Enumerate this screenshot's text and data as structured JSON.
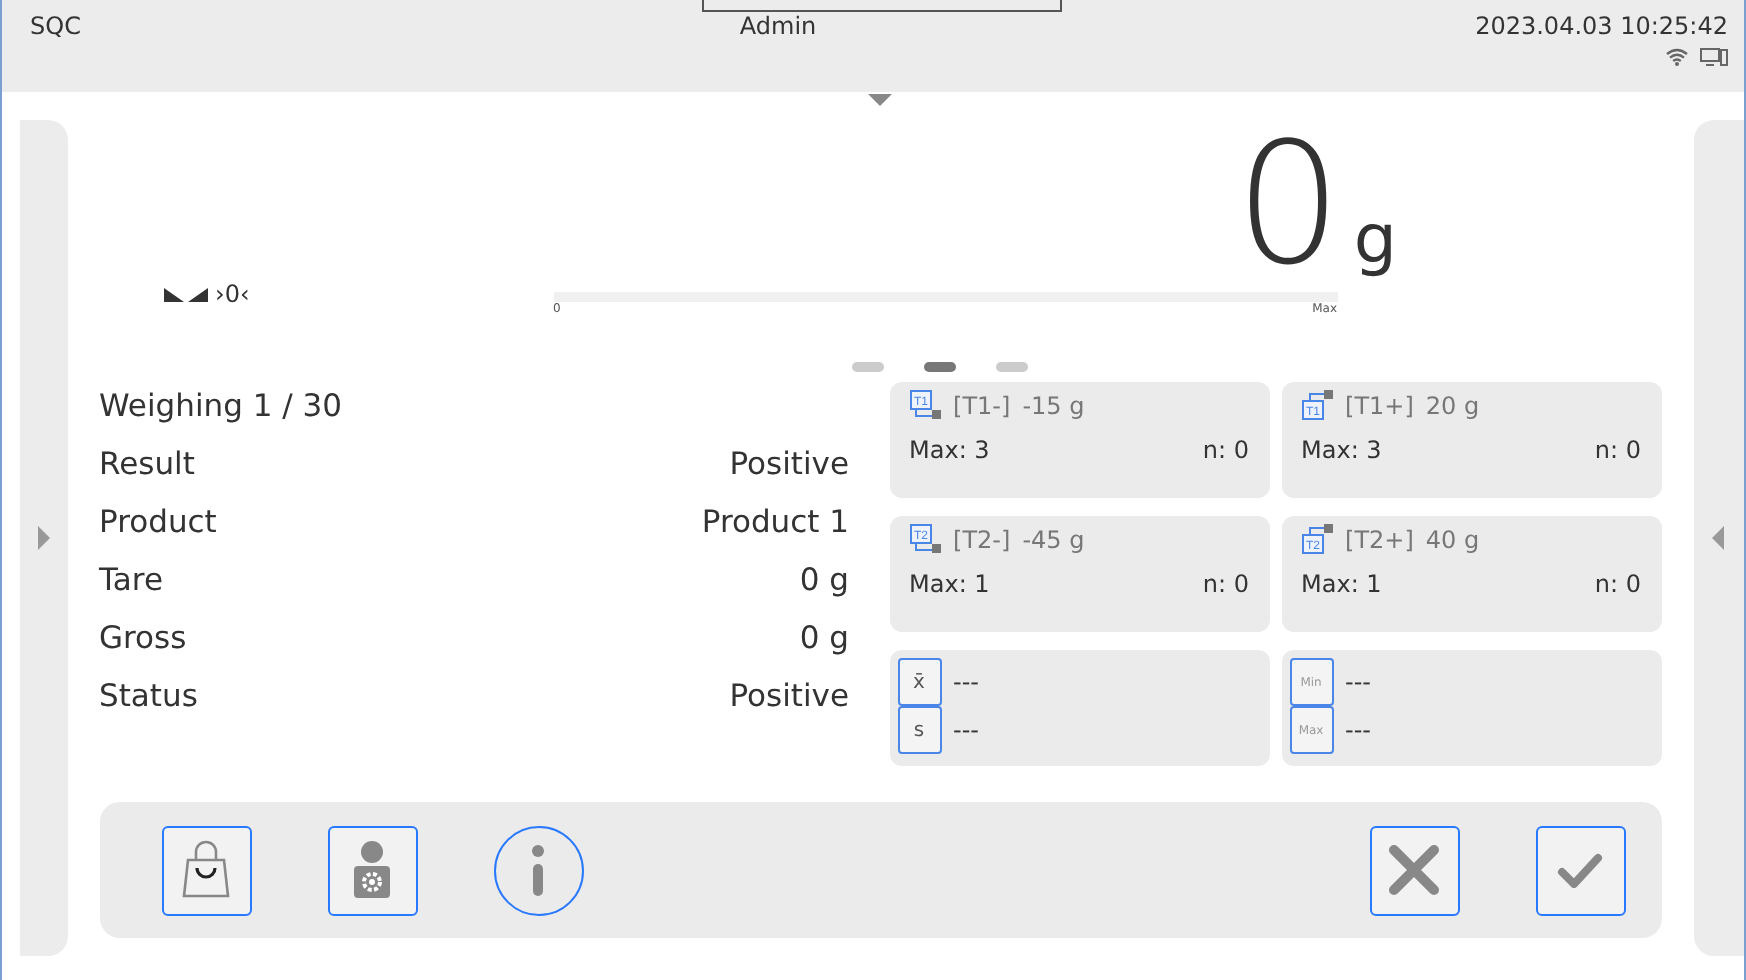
{
  "status_bar": {
    "mode": "SQC",
    "user": "Admin",
    "datetime": "2023.04.03 10:25:42"
  },
  "display": {
    "value": "0",
    "unit": "g",
    "zero_indicator": "›0‹",
    "bar": {
      "min_label": "0",
      "max_label": "Max",
      "level": 0
    }
  },
  "pages": [
    {
      "selected": false
    },
    {
      "selected": true
    },
    {
      "selected": false
    }
  ],
  "info": [
    {
      "label": "Weighing 1 / 30"
    },
    {
      "label": "Result",
      "value": "Positive"
    },
    {
      "label": "Product",
      "value": "Product 1"
    },
    {
      "label": "Tare",
      "value": "0 g"
    },
    {
      "label": "Gross",
      "value": "0 g"
    },
    {
      "label": "Status",
      "value": "Positive"
    }
  ],
  "thresholds": [
    {
      "kind": "minus",
      "code": "[T1-]",
      "value": "-15 g",
      "max": "Max: 3",
      "n": "n: 0",
      "icon_label": "T1"
    },
    {
      "kind": "plus",
      "code": "[T1+]",
      "value": "20 g",
      "max": "Max: 3",
      "n": "n: 0",
      "icon_label": "T1"
    },
    {
      "kind": "minus",
      "code": "[T2-]",
      "value": "-45 g",
      "max": "Max: 1",
      "n": "n: 0",
      "icon_label": "T2"
    },
    {
      "kind": "plus",
      "code": "[T2+]",
      "value": "40 g",
      "max": "Max: 1",
      "n": "n: 0",
      "icon_label": "T2"
    }
  ],
  "statistics": [
    [
      {
        "symbol": "x̄",
        "value": "---"
      },
      {
        "symbol": "s",
        "value": "---"
      }
    ],
    [
      {
        "symbol": "Min",
        "value": "---"
      },
      {
        "symbol": "Max",
        "value": "---"
      }
    ]
  ]
}
